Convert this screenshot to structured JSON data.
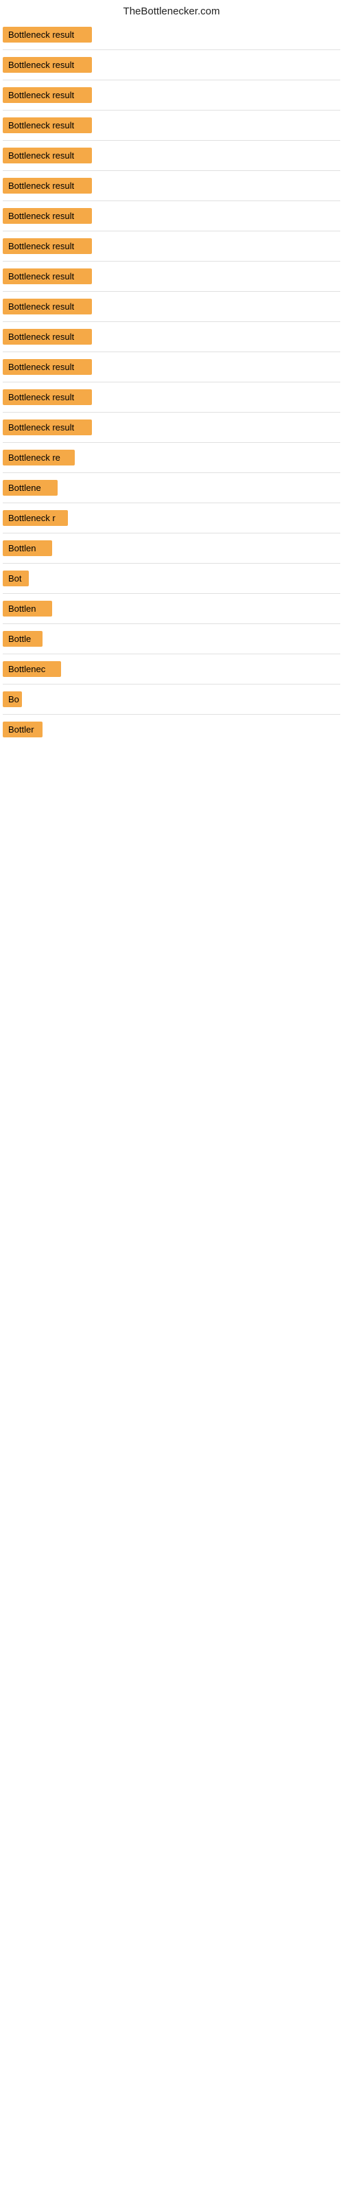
{
  "header": {
    "title": "TheBottlenecker.com"
  },
  "cards": [
    {
      "label": "Bottleneck result",
      "width": 130
    },
    {
      "label": "Bottleneck result",
      "width": 130
    },
    {
      "label": "Bottleneck result",
      "width": 130
    },
    {
      "label": "Bottleneck result",
      "width": 130
    },
    {
      "label": "Bottleneck result",
      "width": 130
    },
    {
      "label": "Bottleneck result",
      "width": 130
    },
    {
      "label": "Bottleneck result",
      "width": 130
    },
    {
      "label": "Bottleneck result",
      "width": 130
    },
    {
      "label": "Bottleneck result",
      "width": 130
    },
    {
      "label": "Bottleneck result",
      "width": 130
    },
    {
      "label": "Bottleneck result",
      "width": 130
    },
    {
      "label": "Bottleneck result",
      "width": 130
    },
    {
      "label": "Bottleneck result",
      "width": 130
    },
    {
      "label": "Bottleneck result",
      "width": 130
    },
    {
      "label": "Bottleneck re",
      "width": 105
    },
    {
      "label": "Bottlene",
      "width": 80
    },
    {
      "label": "Bottleneck r",
      "width": 95
    },
    {
      "label": "Bottlen",
      "width": 72
    },
    {
      "label": "Bot",
      "width": 38
    },
    {
      "label": "Bottlen",
      "width": 72
    },
    {
      "label": "Bottle",
      "width": 58
    },
    {
      "label": "Bottlenec",
      "width": 85
    },
    {
      "label": "Bo",
      "width": 28
    },
    {
      "label": "Bottler",
      "width": 58
    }
  ],
  "accent_color": "#f5a947"
}
